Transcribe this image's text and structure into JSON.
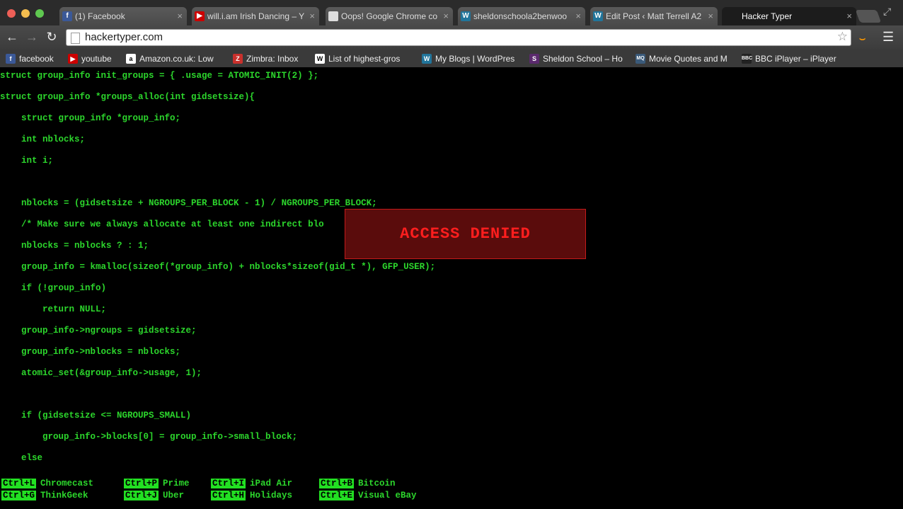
{
  "tabs": [
    {
      "title": "(1) Facebook",
      "icon": "facebook-icon",
      "color": "#3b5998",
      "glyph": "f"
    },
    {
      "title": "will.i.am Irish Dancing – Y",
      "icon": "youtube-icon",
      "color": "#cc0000",
      "glyph": "▶"
    },
    {
      "title": "Oops! Google Chrome co",
      "icon": "page-icon",
      "color": "#dddddd",
      "glyph": ""
    },
    {
      "title": "sheldonschoola2benwoo",
      "icon": "wordpress-icon",
      "color": "#21759b",
      "glyph": "W"
    },
    {
      "title": "Edit Post ‹ Matt Terrell A2",
      "icon": "wordpress-icon",
      "color": "#21759b",
      "glyph": "W"
    },
    {
      "title": "Hacker Typer",
      "icon": "",
      "color": "",
      "glyph": ""
    }
  ],
  "url": "hackertyper.com",
  "bookmarks": [
    {
      "label": "facebook",
      "icon": "facebook-icon",
      "color": "#3b5998",
      "glyph": "f"
    },
    {
      "label": "youtube",
      "icon": "youtube-icon",
      "color": "#cc0000",
      "glyph": "▶"
    },
    {
      "label": "Amazon.co.uk: Low",
      "icon": "amazon-icon",
      "color": "#ffffff",
      "glyph": "a"
    },
    {
      "label": "Zimbra: Inbox",
      "icon": "zimbra-icon",
      "color": "#c9302c",
      "glyph": "Z"
    },
    {
      "label": "List of highest-gros",
      "icon": "wikipedia-icon",
      "color": "#ffffff",
      "glyph": "W"
    },
    {
      "label": "My Blogs | WordPres",
      "icon": "wordpress-icon",
      "color": "#21759b",
      "glyph": "W"
    },
    {
      "label": "Sheldon School – Ho",
      "icon": "sheldon-icon",
      "color": "#5b2a6e",
      "glyph": "S"
    },
    {
      "label": "Movie Quotes and M",
      "icon": "movie-quotes-icon",
      "color": "#3a5a7a",
      "glyph": "MQ"
    },
    {
      "label": "BBC iPlayer – iPlayer",
      "icon": "bbc-icon",
      "color": "#222222",
      "glyph": "BBC"
    }
  ],
  "code_lines": [
    "struct group_info init_groups = { .usage = ATOMIC_INIT(2) };",
    "struct group_info *groups_alloc(int gidsetsize){",
    "    struct group_info *group_info;",
    "    int nblocks;",
    "    int i;",
    "",
    "    nblocks = (gidsetsize + NGROUPS_PER_BLOCK - 1) / NGROUPS_PER_BLOCK;",
    "    /* Make sure we always allocate at least one indirect blo",
    "    nblocks = nblocks ? : 1;",
    "    group_info = kmalloc(sizeof(*group_info) + nblocks*sizeof(gid_t *), GFP_USER);",
    "    if (!group_info)",
    "        return NULL;",
    "    group_info->ngroups = gidsetsize;",
    "    group_info->nblocks = nblocks;",
    "    atomic_set(&group_info->usage, 1);",
    "",
    "    if (gidsetsize <= NGROUPS_SMALL)",
    "        group_info->blocks[0] = group_info->small_block;",
    "    else"
  ],
  "access_denied": "ACCESS DENIED",
  "shortcuts": [
    {
      "key": "Ctrl+L",
      "label": "Chromecast"
    },
    {
      "key": "Ctrl+P",
      "label": "Prime"
    },
    {
      "key": "Ctrl+I",
      "label": "iPad Air"
    },
    {
      "key": "Ctrl+B",
      "label": "Bitcoin"
    },
    {
      "key": "Ctrl+G",
      "label": "ThinkGeek"
    },
    {
      "key": "Ctrl+J",
      "label": "Uber"
    },
    {
      "key": "Ctrl+H",
      "label": "Holidays"
    },
    {
      "key": "Ctrl+E",
      "label": "Visual eBay"
    }
  ]
}
